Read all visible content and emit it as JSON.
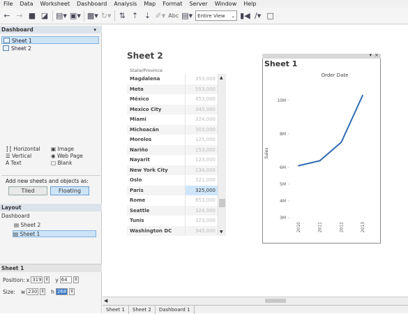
{
  "menu": [
    "File",
    "Data",
    "Worksheet",
    "Dashboard",
    "Analysis",
    "Map",
    "Format",
    "Server",
    "Window",
    "Help"
  ],
  "toolbar": {
    "fit_select": "Entire View",
    "abc_label": "Abc"
  },
  "dashboard_pane": {
    "header": "Dashboard",
    "sheets": [
      "Sheet 1",
      "Sheet 2"
    ],
    "objects": [
      [
        "Horizontal",
        "Image"
      ],
      [
        "Vertical",
        "Web Page"
      ],
      [
        "Text",
        "Blank"
      ]
    ],
    "add_new_label": "Add new sheets and objects as:",
    "tiled_label": "Tiled",
    "floating_label": "Floating"
  },
  "layout_pane": {
    "header": "Layout",
    "root": "Dashboard",
    "items": [
      "Sheet 2",
      "Sheet 1"
    ]
  },
  "sheet_props": {
    "header": "Sheet 1",
    "position_label": "Position:",
    "x_label": "x",
    "x_value": "319",
    "y_label": "y",
    "y_value": "64",
    "size_label": "Size:",
    "w_label": "w",
    "w_value": "230",
    "h_label": "h",
    "h_value": "268"
  },
  "sheet2": {
    "title": "Sheet 2",
    "column_header": "State/Province",
    "rows": [
      {
        "name": "Magdalena",
        "value": "353,000"
      },
      {
        "name": "Meta",
        "value": "553,000"
      },
      {
        "name": "México",
        "value": "453,000"
      },
      {
        "name": "Mexico City",
        "value": "345,000"
      },
      {
        "name": "Miami",
        "value": "324,000"
      },
      {
        "name": "Michoacán",
        "value": "303,000"
      },
      {
        "name": "Morelos",
        "value": "125,000"
      },
      {
        "name": "Nariño",
        "value": "153,000"
      },
      {
        "name": "Nayarit",
        "value": "123,000"
      },
      {
        "name": "New York City",
        "value": "234,000"
      },
      {
        "name": "Oslo",
        "value": "321,000"
      },
      {
        "name": "Paris",
        "value": "325,000"
      },
      {
        "name": "Rome",
        "value": "853,000"
      },
      {
        "name": "Seattle",
        "value": "324,000"
      },
      {
        "name": "Tunis",
        "value": "323,000"
      },
      {
        "name": "Washington DC",
        "value": "345,000"
      }
    ]
  },
  "sheet1": {
    "title": "Sheet 1"
  },
  "chart_data": {
    "type": "line",
    "title": "Order Date",
    "ylabel": "Sales",
    "x": [
      "2010",
      "2011",
      "2012",
      "2013"
    ],
    "series": [
      {
        "values": [
          6100000,
          6400000,
          7500000,
          10300000
        ]
      }
    ],
    "yticks": [
      "3M",
      "4M",
      "5M",
      "6M",
      "8M",
      "10M"
    ],
    "yticks_values": [
      3000000,
      4000000,
      5000000,
      6000000,
      8000000,
      10000000
    ],
    "ylim": [
      3000000,
      10700000
    ],
    "line_color": "#2e6bb0"
  },
  "tabs": [
    "Sheet 1",
    "Sheet 2",
    "Dashboard 1"
  ]
}
